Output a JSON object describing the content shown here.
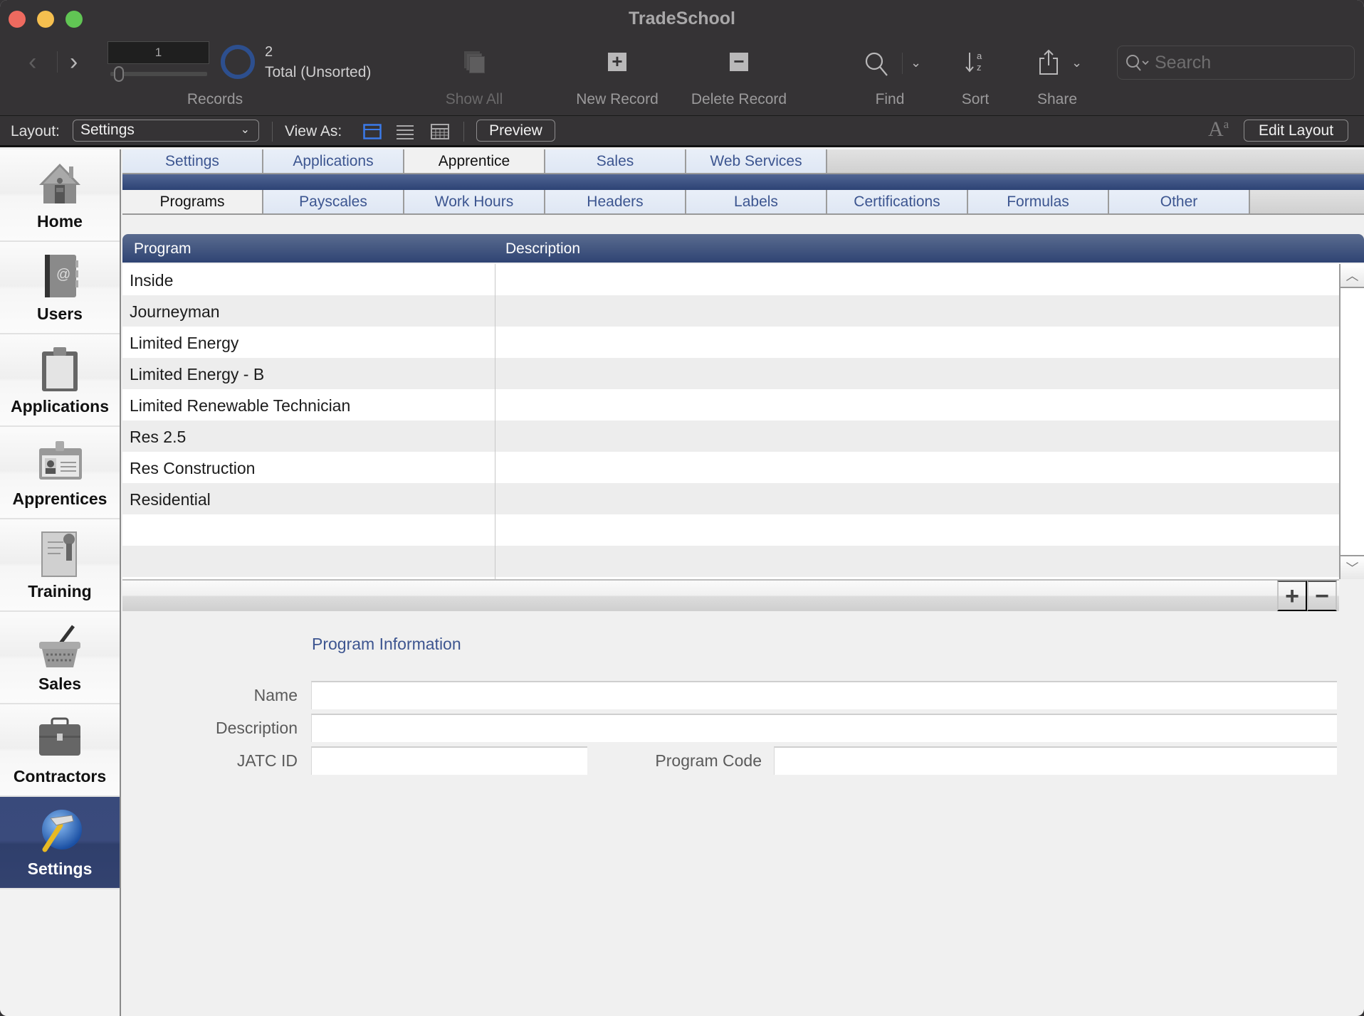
{
  "window": {
    "title": "TradeSchool"
  },
  "toolbar": {
    "record_number": "1",
    "record_count": "2",
    "record_status": "Total (Unsorted)",
    "records_label": "Records",
    "show_all_label": "Show All",
    "new_record_label": "New Record",
    "delete_record_label": "Delete Record",
    "find_label": "Find",
    "sort_label": "Sort",
    "share_label": "Share",
    "search_placeholder": "Search",
    "search_value": ""
  },
  "layoutbar": {
    "layout_label": "Layout:",
    "layout_value": "Settings",
    "view_as_label": "View As:",
    "view_modes": [
      "form-view",
      "list-view",
      "table-view"
    ],
    "active_view": "form-view",
    "preview_label": "Preview",
    "edit_layout_label": "Edit Layout"
  },
  "sidebar": {
    "items": [
      {
        "label": "Home",
        "icon": "house-icon"
      },
      {
        "label": "Users",
        "icon": "address-book-icon"
      },
      {
        "label": "Applications",
        "icon": "clipboard-icon"
      },
      {
        "label": "Apprentices",
        "icon": "id-badge-icon"
      },
      {
        "label": "Training",
        "icon": "certificate-icon"
      },
      {
        "label": "Sales",
        "icon": "basket-icon"
      },
      {
        "label": "Contractors",
        "icon": "briefcase-icon"
      },
      {
        "label": "Settings",
        "icon": "hammer-globe-icon",
        "active": true
      }
    ]
  },
  "tabs": {
    "primary": [
      "Settings",
      "Applications",
      "Apprentice",
      "Sales",
      "Web Services"
    ],
    "primary_active": "Apprentice",
    "secondary": [
      "Programs",
      "Payscales",
      "Work Hours",
      "Headers",
      "Labels",
      "Certifications",
      "Formulas",
      "Other"
    ],
    "secondary_active": "Programs"
  },
  "portal": {
    "columns": [
      "Program",
      "Description"
    ],
    "rows": [
      {
        "program": "Inside",
        "description": ""
      },
      {
        "program": "Journeyman",
        "description": ""
      },
      {
        "program": "Limited Energy",
        "description": ""
      },
      {
        "program": "Limited Energy - B",
        "description": ""
      },
      {
        "program": "Limited Renewable Technician",
        "description": ""
      },
      {
        "program": "Res 2.5",
        "description": ""
      },
      {
        "program": "Res Construction",
        "description": ""
      },
      {
        "program": "Residential",
        "description": ""
      },
      {
        "program": "",
        "description": ""
      },
      {
        "program": "",
        "description": ""
      }
    ],
    "add_label": "+",
    "remove_label": "−"
  },
  "form": {
    "section_title": "Program Information",
    "fields": {
      "name": {
        "label": "Name",
        "value": ""
      },
      "description": {
        "label": "Description",
        "value": ""
      },
      "jatc_id": {
        "label": "JATC ID",
        "value": ""
      },
      "program_code": {
        "label": "Program Code",
        "value": ""
      }
    }
  },
  "colors": {
    "accent_blue": "#2d4375",
    "tab_text": "#3c5590",
    "record_ring": "#2d4f8e",
    "view_active": "#3b7bea"
  }
}
